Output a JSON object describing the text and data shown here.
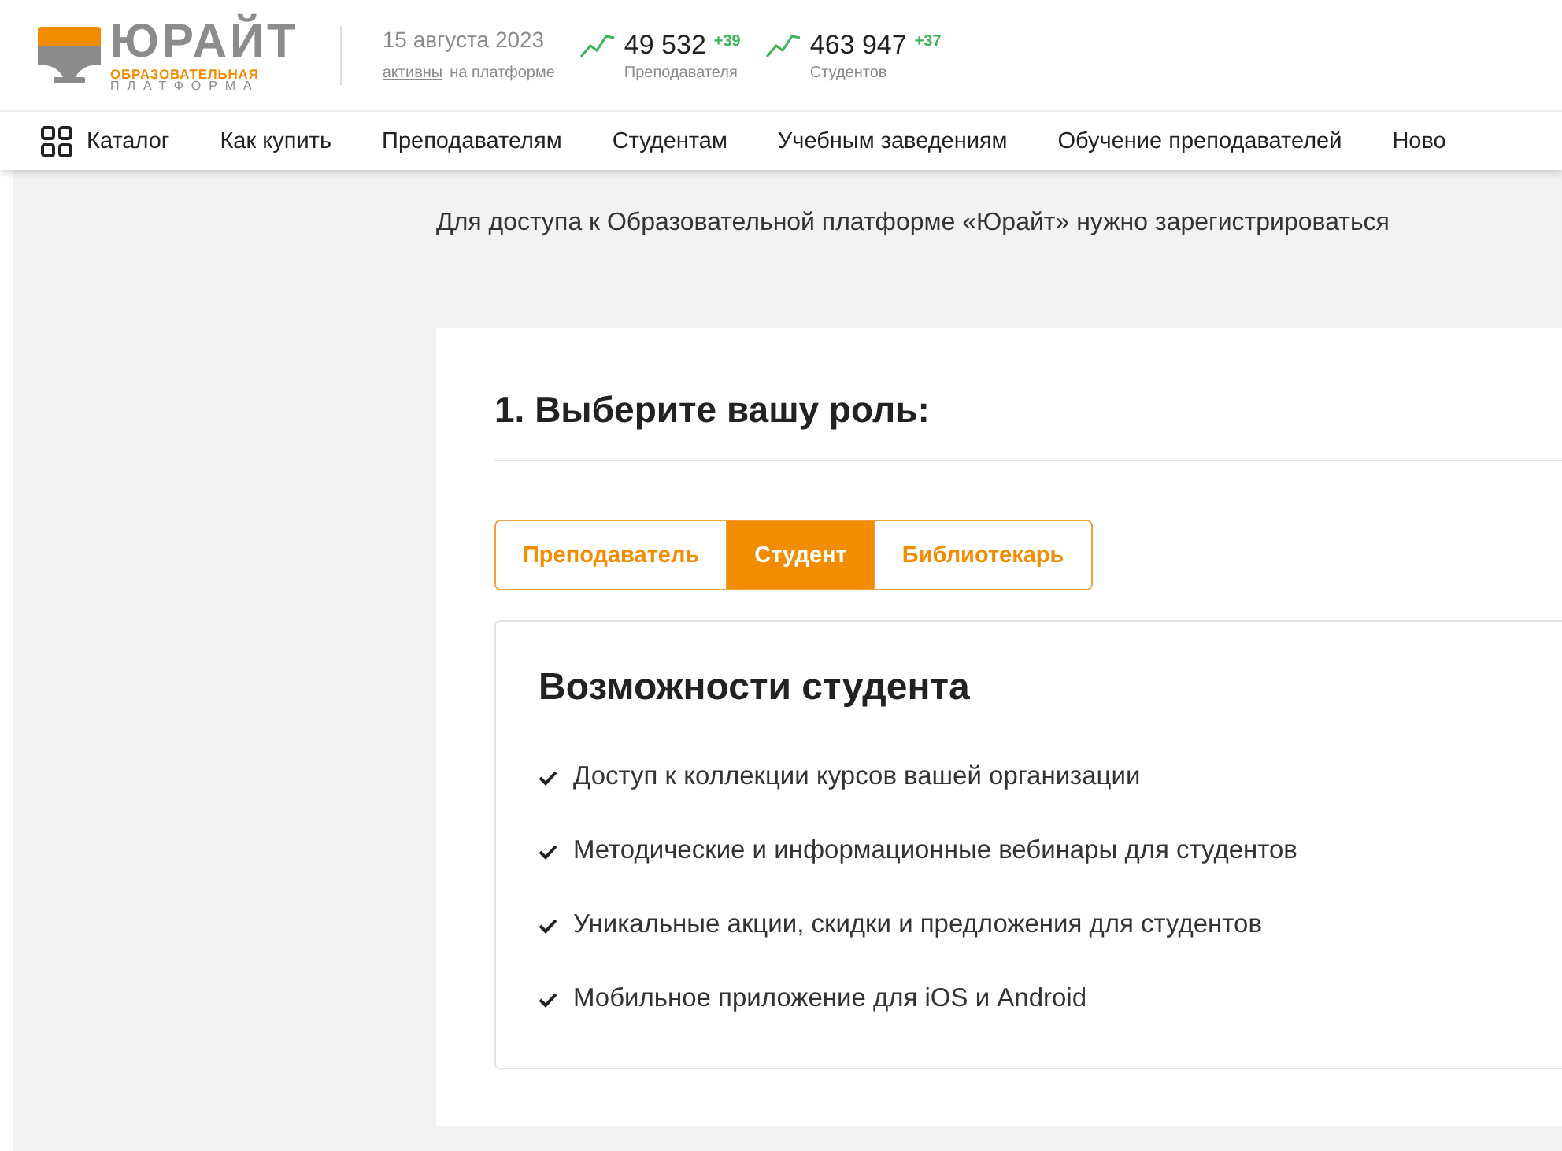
{
  "header": {
    "logo": {
      "name": "ЮРАЙТ",
      "line1": "ОБРАЗОВАТЕЛЬНАЯ",
      "line2": "ПЛАТФОРМА"
    },
    "date": "15 августа 2023",
    "active_link": "активны",
    "active_rest": "на платформе",
    "stats": [
      {
        "value": "49 532",
        "delta": "+39",
        "label": "Преподавателя"
      },
      {
        "value": "463 947",
        "delta": "+37",
        "label": "Студентов"
      }
    ]
  },
  "nav": [
    {
      "label": "Каталог",
      "kind": "catalog"
    },
    {
      "label": "Как купить",
      "kind": "link"
    },
    {
      "label": "Преподавателям",
      "kind": "link"
    },
    {
      "label": "Студентам",
      "kind": "link"
    },
    {
      "label": "Учебным заведениям",
      "kind": "link"
    },
    {
      "label": "Обучение преподавателей",
      "kind": "link"
    },
    {
      "label": "Ново",
      "kind": "link"
    }
  ],
  "intro": "Для доступа к Образовательной платформе «Юрайт» нужно зарегистрироваться",
  "step": {
    "title": "1. Выберите вашу роль:",
    "roles": [
      {
        "label": "Преподаватель",
        "selected": false
      },
      {
        "label": "Студент",
        "selected": true
      },
      {
        "label": "Библиотекарь",
        "selected": false
      }
    ],
    "features": {
      "title": "Возможности студента",
      "items": [
        "Доступ к коллекции курсов вашей организации",
        "Методические и информационные вебинары для студентов",
        "Уникальные акции, скидки и предложения для студентов",
        "Мобильное приложение для iOS и Android"
      ]
    }
  }
}
